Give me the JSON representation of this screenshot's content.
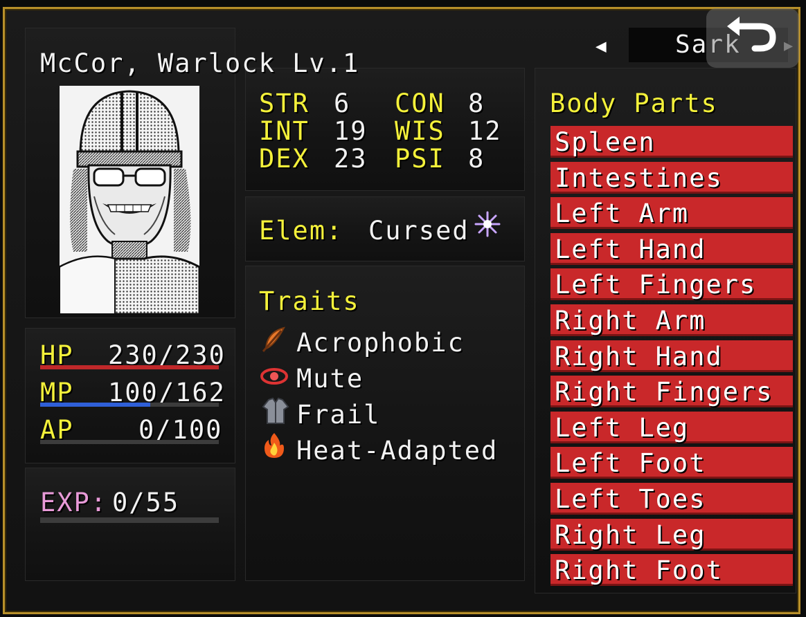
{
  "character": {
    "name_line": "McCor, Warlock Lv.1",
    "nav_name": "Sark"
  },
  "stats": {
    "str_label": "STR",
    "str_value": "6",
    "con_label": "CON",
    "con_value": "8",
    "int_label": "INT",
    "int_value": "19",
    "wis_label": "WIS",
    "wis_value": "12",
    "dex_label": "DEX",
    "dex_value": "23",
    "psi_label": "PSI",
    "psi_value": "8"
  },
  "element": {
    "label": "Elem:",
    "value": "Cursed",
    "icon": "purple-sparkle-icon"
  },
  "vitals": {
    "hp_label": "HP",
    "hp_value": "230/230",
    "hp_fill": 1.0,
    "hp_color": "#c0282a",
    "mp_label": "MP",
    "mp_value": "100/162",
    "mp_fill": 0.617,
    "mp_color": "#2f5fd8",
    "ap_label": "AP",
    "ap_value": "0/100",
    "ap_fill": 0.0,
    "ap_color": "#888888"
  },
  "exp": {
    "label": "EXP:",
    "value": "0/55",
    "fill": 0.0
  },
  "traits": {
    "title": "Traits",
    "items": [
      {
        "label": "Acrophobic",
        "icon": "feather-icon"
      },
      {
        "label": "Mute",
        "icon": "gag-icon"
      },
      {
        "label": "Frail",
        "icon": "coat-icon"
      },
      {
        "label": "Heat-Adapted",
        "icon": "fire-icon"
      }
    ]
  },
  "body_parts": {
    "title": "Body Parts",
    "items": [
      "Spleen",
      "Intestines",
      "Left Arm",
      "Left Hand",
      "Left Fingers",
      "Right Arm",
      "Right Hand",
      "Right Fingers",
      "Left Leg",
      "Left Foot",
      "Left Toes",
      "Right Leg",
      "Right Foot"
    ],
    "row_color": "#c9282a"
  }
}
